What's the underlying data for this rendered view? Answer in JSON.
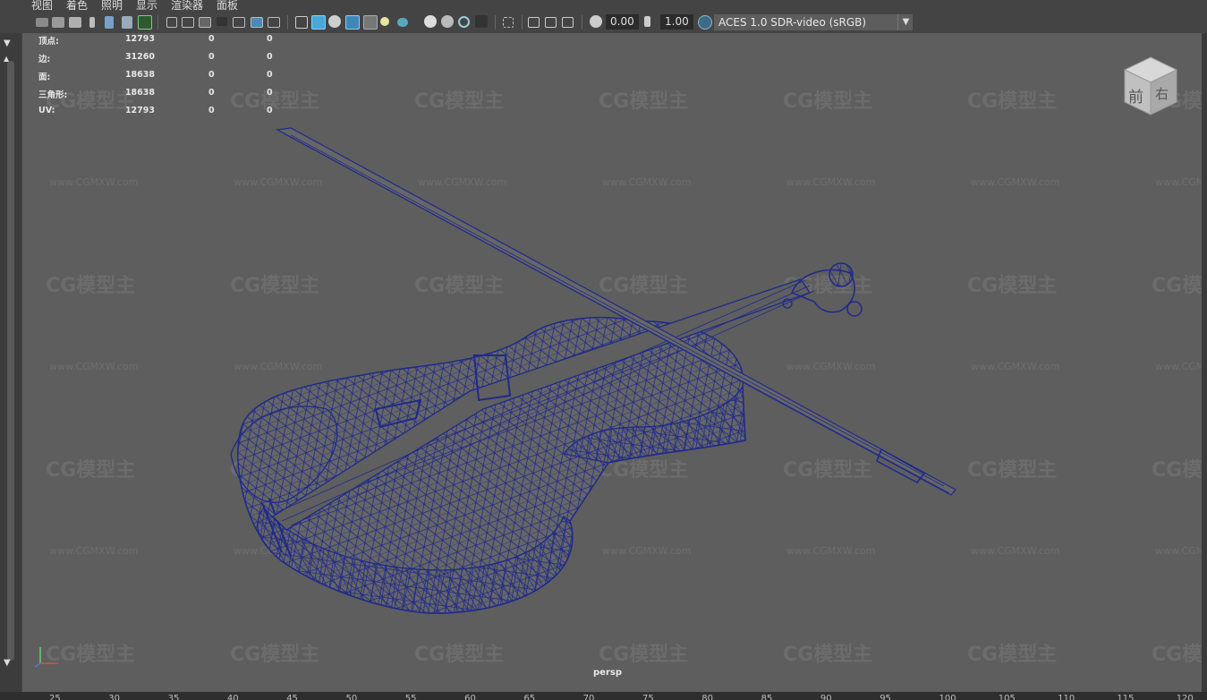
{
  "menubar": {
    "items": [
      "视图",
      "着色",
      "照明",
      "显示",
      "渲染器",
      "面板"
    ]
  },
  "toolbar": {
    "exposure": "0.00",
    "gamma": "1.00",
    "color_space": "ACES 1.0 SDR-video (sRGB)",
    "icons": [
      "camera-icon",
      "camera-attr-icon",
      "bookmark-icon",
      "2d-pan-icon",
      "grease-pencil-icon",
      "grid-icon",
      "film-gate-icon",
      "resolution-gate-icon",
      "gate-mask-icon",
      "field-chart-icon",
      "safe-action-icon",
      "safe-title-icon",
      "wireframe-icon",
      "smooth-shade-icon",
      "default-material-icon",
      "wireframe-on-shaded-icon",
      "textured-icon",
      "lights-icon",
      "shadows-icon",
      "screen-space-ao-icon",
      "motion-blur-icon",
      "anti-alias-icon",
      "depth-of-field-icon",
      "isolate-select-icon",
      "xray-icon",
      "xray-joints-icon",
      "backface-icon",
      "exposure-icon",
      "gamma-icon",
      "color-management-icon"
    ]
  },
  "heads_up": {
    "rows": [
      {
        "label": "顶点:",
        "v1": "12793",
        "v2": "0",
        "v3": "0"
      },
      {
        "label": "边:",
        "v1": "31260",
        "v2": "0",
        "v3": "0"
      },
      {
        "label": "面:",
        "v1": "18638",
        "v2": "0",
        "v3": "0"
      },
      {
        "label": "三角形:",
        "v1": "18638",
        "v2": "0",
        "v3": "0"
      },
      {
        "label": "UV:",
        "v1": "12793",
        "v2": "0",
        "v3": "0"
      }
    ]
  },
  "viewcube": {
    "front": "前",
    "right": "右"
  },
  "viewport": {
    "camera": "persp"
  },
  "watermark": {
    "logo": "CG模型主",
    "url": "www.CGMXW.com"
  },
  "timeline": {
    "ticks": [
      "25",
      "30",
      "35",
      "40",
      "45",
      "50",
      "55",
      "60",
      "65",
      "70",
      "75",
      "80",
      "85",
      "90",
      "95",
      "100",
      "105",
      "110",
      "115",
      "120"
    ]
  },
  "colors": {
    "wire": "#1f2a8a",
    "viewport_bg": "#5e5e5e"
  }
}
